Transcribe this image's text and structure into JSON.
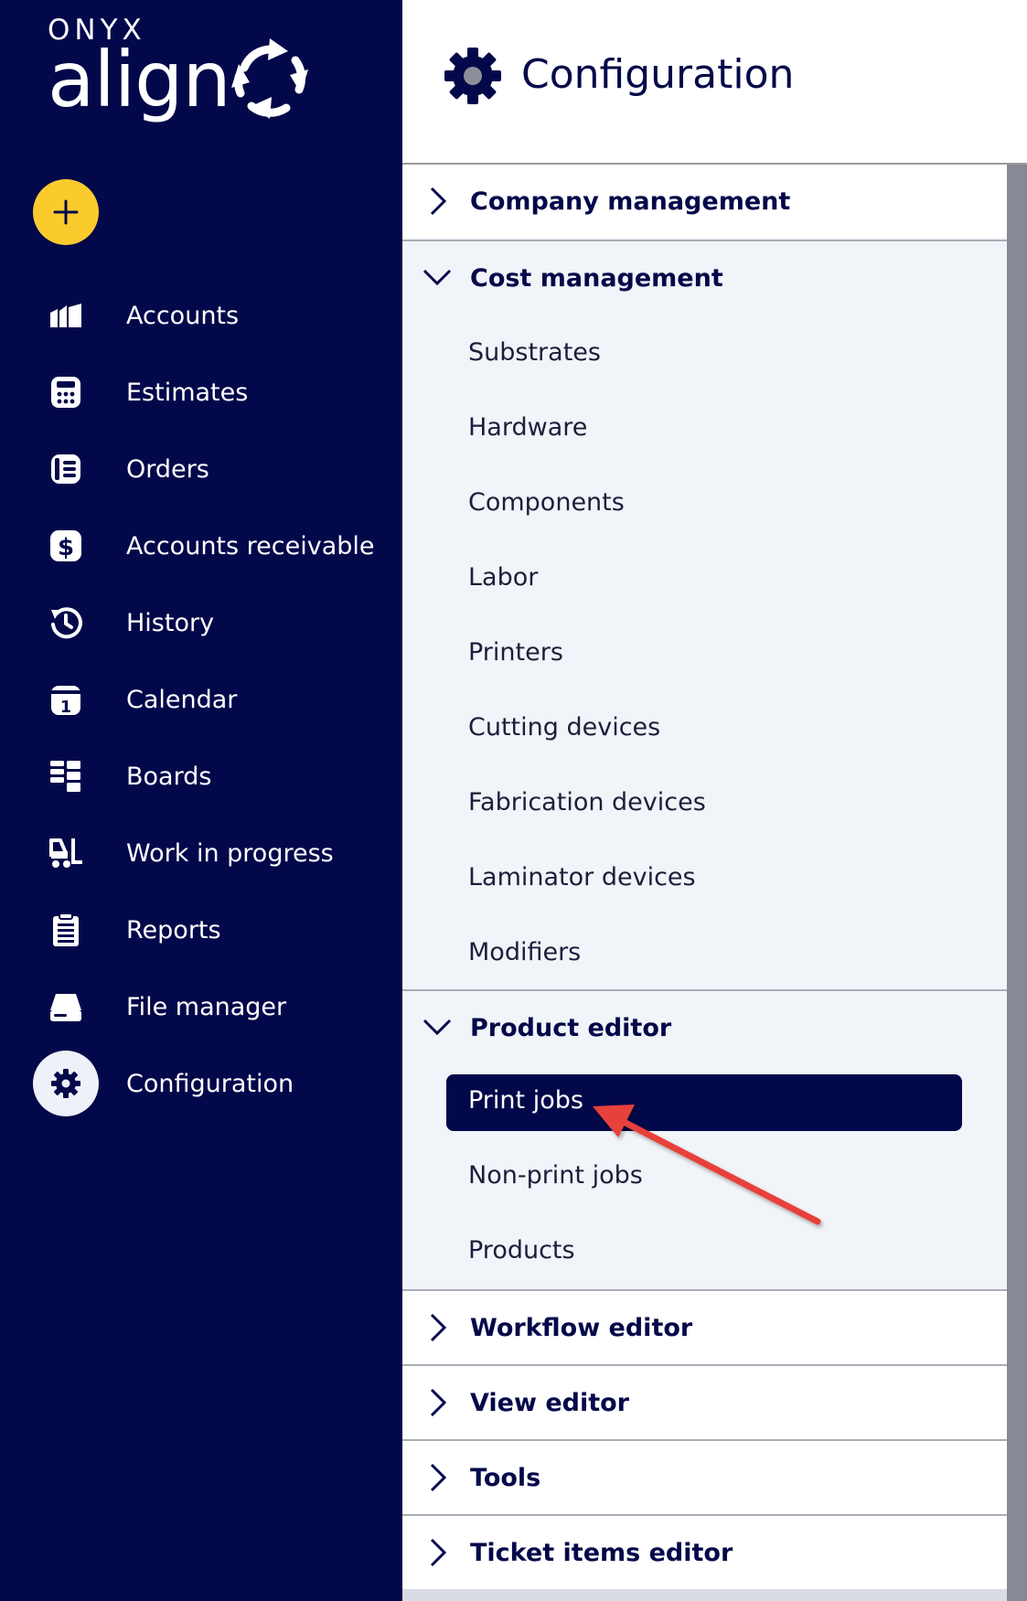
{
  "app": {
    "logo_top": "ONYX",
    "logo_bottom": "align"
  },
  "sidebar": {
    "add_button_icon": "plus-icon",
    "items": [
      {
        "label": "Accounts",
        "icon": "accounts-icon"
      },
      {
        "label": "Estimates",
        "icon": "calculator-icon"
      },
      {
        "label": "Orders",
        "icon": "orders-icon"
      },
      {
        "label": "Accounts receivable",
        "icon": "dollar-icon"
      },
      {
        "label": "History",
        "icon": "history-icon"
      },
      {
        "label": "Calendar",
        "icon": "calendar-icon"
      },
      {
        "label": "Boards",
        "icon": "boards-icon"
      },
      {
        "label": "Work in progress",
        "icon": "forklift-icon"
      },
      {
        "label": "Reports",
        "icon": "clipboard-icon"
      },
      {
        "label": "File manager",
        "icon": "drive-icon"
      },
      {
        "label": "Configuration",
        "icon": "gear-icon",
        "active": true
      }
    ]
  },
  "header": {
    "title": "Configuration",
    "icon": "gear-icon"
  },
  "config": {
    "company_management": {
      "title": "Company management",
      "expanded": false
    },
    "cost_management": {
      "title": "Cost management",
      "expanded": true,
      "items": [
        "Substrates",
        "Hardware",
        "Components",
        "Labor",
        "Printers",
        "Cutting devices",
        "Fabrication devices",
        "Laminator devices",
        "Modifiers"
      ]
    },
    "product_editor": {
      "title": "Product editor",
      "expanded": true,
      "selected": "Print jobs",
      "items": [
        "Non-print jobs",
        "Products"
      ]
    },
    "workflow_editor": {
      "title": "Workflow editor",
      "expanded": false
    },
    "view_editor": {
      "title": "View editor",
      "expanded": false
    },
    "tools": {
      "title": "Tools",
      "expanded": false
    },
    "ticket_items_editor": {
      "title": "Ticket items editor",
      "expanded": false
    }
  },
  "colors": {
    "sidebar_bg": "#03084a",
    "accent_yellow": "#fbcb2e",
    "content_bg": "#f1f4f8",
    "annotation_arrow": "#e8403a"
  }
}
